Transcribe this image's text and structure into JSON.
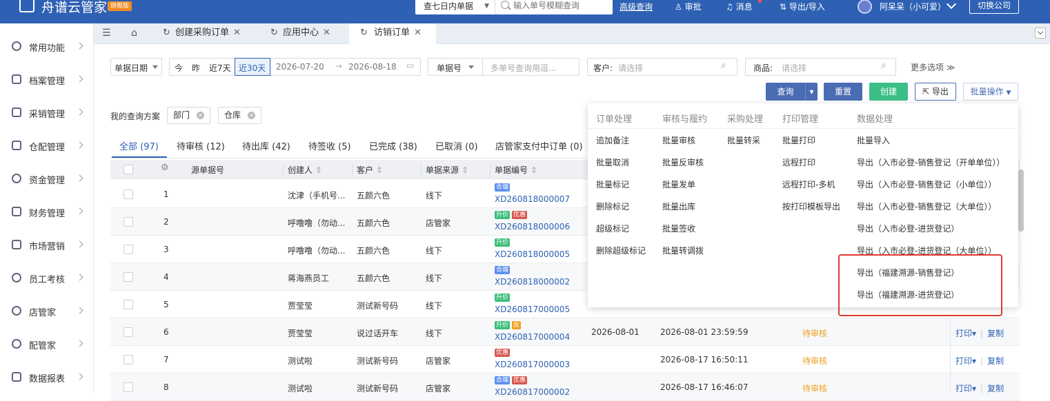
{
  "topbar": {
    "logo_text": "舟谱云管家",
    "logo_badge": "旗舰版",
    "search_scope": "查七日内单据",
    "search_placeholder": "输入单号模糊查询",
    "advanced_search": "高级查询",
    "approve": "审批",
    "messages": "消息",
    "export_import": "导出/导入",
    "user_name": "阿呆呆（小可爱）",
    "switch_company": "切换公司"
  },
  "sidebar": {
    "items": [
      {
        "label": "常用功能"
      },
      {
        "label": "档案管理"
      },
      {
        "label": "采销管理"
      },
      {
        "label": "仓配管理"
      },
      {
        "label": "资金管理"
      },
      {
        "label": "财务管理"
      },
      {
        "label": "市场营销"
      },
      {
        "label": "员工考核"
      },
      {
        "label": "店管家"
      },
      {
        "label": "配管家"
      },
      {
        "label": "数据报表"
      }
    ]
  },
  "tabs": {
    "items": [
      {
        "label": "创建采购订单"
      },
      {
        "label": "应用中心"
      },
      {
        "label": "访销订单"
      }
    ]
  },
  "filters": {
    "date_type": "单据日期",
    "quick_today": "今",
    "quick_yesterday": "昨",
    "quick_7days": "近7天",
    "quick_30days": "近30天",
    "date_start": "2026-07-20",
    "date_end": "2026-08-18",
    "no_type": "单据号",
    "no_placeholder": "多单号查询用逗...",
    "customer_label": "客户:",
    "customer_placeholder": "请选择",
    "product_label": "商品:",
    "product_placeholder": "请选择",
    "more_options": "更多选项"
  },
  "toolbar": {
    "query": "查询",
    "reset": "重置",
    "create": "创建",
    "export": "导出",
    "batch": "批量操作"
  },
  "saved_query": {
    "label": "我的查询方案",
    "chips": [
      "部门",
      "仓库"
    ]
  },
  "status_tabs": [
    {
      "label": "全部 (97)"
    },
    {
      "label": "待审核 (12)"
    },
    {
      "label": "待出库 (42)"
    },
    {
      "label": "待签收 (5)"
    },
    {
      "label": "已完成 (38)"
    },
    {
      "label": "已取消 (0)"
    },
    {
      "label": "店管家支付中订单 (0)"
    }
  ],
  "table": {
    "headers": [
      "源单据号",
      "创建人",
      "客户",
      "单据来源",
      "单据编号"
    ],
    "rows": [
      {
        "index": "1",
        "creator": "沈津（手机号...",
        "customer": "五颜六色",
        "source": "线下",
        "tags": [
          "合端"
        ],
        "order_no": "XD260818000007",
        "date": "",
        "time": "",
        "status": ""
      },
      {
        "index": "2",
        "creator": "呼噜噜（勿动...",
        "customer": "五颜六色",
        "source": "店管家",
        "tags": [
          "升价",
          "优惠"
        ],
        "order_no": "XD260818000006",
        "date": "",
        "time": "",
        "status": ""
      },
      {
        "index": "3",
        "creator": "呼噜噜（勿动...",
        "customer": "五颜六色",
        "source": "线下",
        "tags": [
          "升价"
        ],
        "order_no": "XD260818000005",
        "date": "",
        "time": "",
        "status": ""
      },
      {
        "index": "4",
        "creator": "蒋海燕员工",
        "customer": "五颜六色",
        "source": "线下",
        "tags": [
          "合端"
        ],
        "order_no": "XD260818000002",
        "date": "",
        "time": "",
        "status": ""
      },
      {
        "index": "5",
        "creator": "贾莹莹",
        "customer": "测试新号码",
        "source": "线下",
        "tags": [
          "升价"
        ],
        "order_no": "XD260817000005",
        "date": "",
        "time": "",
        "status": ""
      },
      {
        "index": "6",
        "creator": "贾莹莹",
        "customer": "说过话开车",
        "source": "线下",
        "tags": [
          "升价",
          "反"
        ],
        "order_no": "XD260817000004",
        "date": "2026-08-01",
        "time": "2026-08-01 23:59:59",
        "status": "待审核"
      },
      {
        "index": "7",
        "creator": "测试啦",
        "customer": "测试新号码",
        "source": "店管家",
        "tags": [
          "优惠"
        ],
        "order_no": "XD260817000003",
        "date": "",
        "time": "2026-08-17 16:50:11",
        "status": "待审核"
      },
      {
        "index": "8",
        "creator": "测试啦",
        "customer": "测试新号码",
        "source": "店管家",
        "tags": [
          "合端",
          "优惠"
        ],
        "order_no": "XD260817000002",
        "date": "",
        "time": "2026-08-17 16:46:07",
        "status": "待审核"
      }
    ],
    "action_print": "打印",
    "action_copy": "复制"
  },
  "batch_menu": {
    "columns": [
      {
        "header": "订单处理",
        "items": [
          "追加备注",
          "批量取消",
          "批量标记",
          "删除标记",
          "超级标记",
          "删除超级标记"
        ]
      },
      {
        "header": "审核与履约",
        "items": [
          "批量审核",
          "批量反审核",
          "批量发单",
          "批量出库",
          "批量签收",
          "批量转调拨"
        ]
      },
      {
        "header": "采购处理",
        "items": [
          "批量转采"
        ]
      },
      {
        "header": "打印管理",
        "items": [
          "批量打印",
          "远程打印",
          "远程打印-多机",
          "按打印模板导出"
        ]
      },
      {
        "header": "数据处理",
        "items": [
          "批量导入",
          "导出（入市必登-销售登记（开单单位））",
          "导出（入市必登-销售登记（小单位））",
          "导出（入市必登-销售登记（大单位））",
          "导出（入市必登-进货登记）",
          "导出（入市必登-进货登记（大单位））",
          "导出（福建溯源-销售登记）",
          "导出（福建溯源-进货登记）"
        ]
      }
    ]
  }
}
